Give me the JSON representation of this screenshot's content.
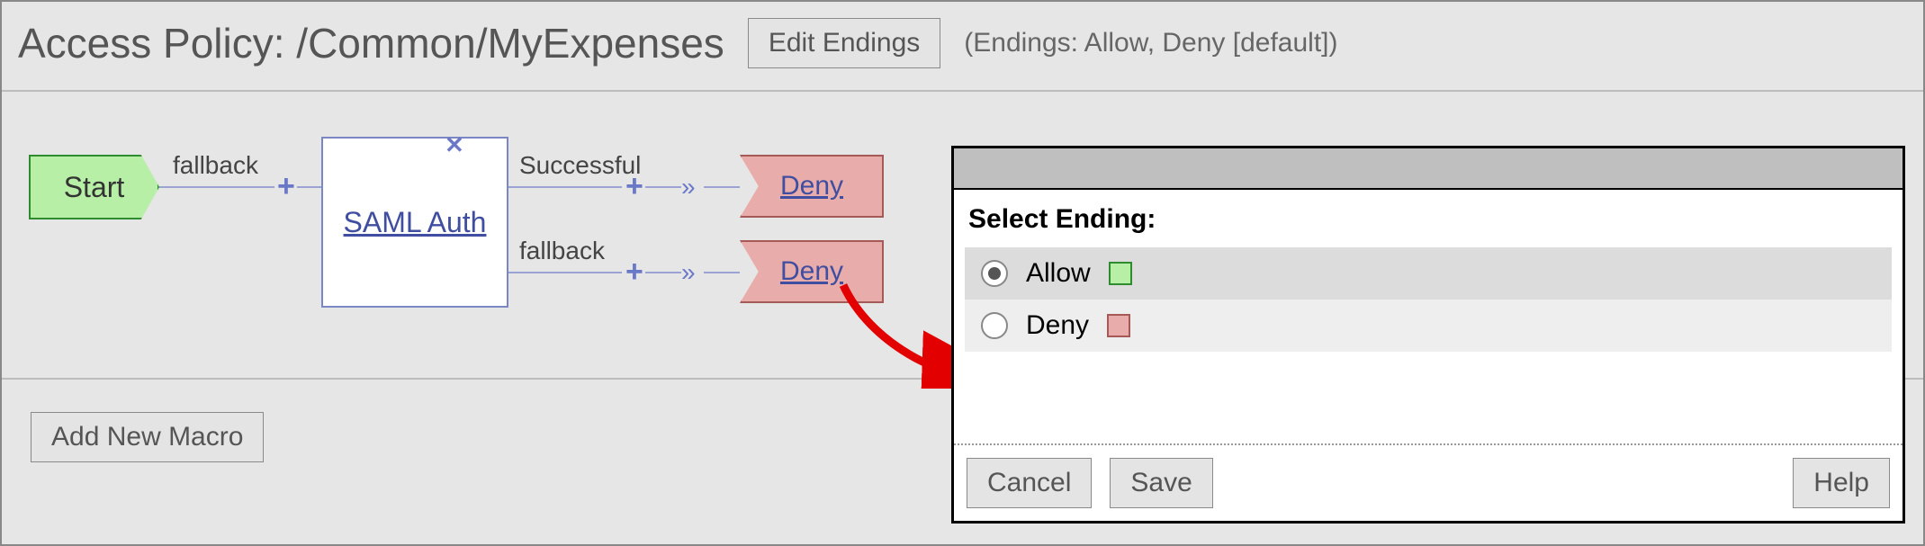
{
  "header": {
    "title": "Access Policy: /Common/MyExpenses",
    "edit_endings_label": "Edit Endings",
    "endings_note": "(Endings: Allow, Deny [default])"
  },
  "diagram": {
    "start_label": "Start",
    "fallback_label_1": "fallback",
    "action_label": "SAML Auth",
    "branches": [
      {
        "label": "Successful",
        "ending": "Deny"
      },
      {
        "label": "fallback",
        "ending": "Deny"
      }
    ]
  },
  "macro": {
    "add_label": "Add New Macro"
  },
  "dialog": {
    "heading": "Select Ending:",
    "options": [
      {
        "label": "Allow",
        "selected": true,
        "swatch": "allow"
      },
      {
        "label": "Deny",
        "selected": false,
        "swatch": "deny"
      }
    ],
    "buttons": {
      "cancel": "Cancel",
      "save": "Save",
      "help": "Help"
    }
  }
}
